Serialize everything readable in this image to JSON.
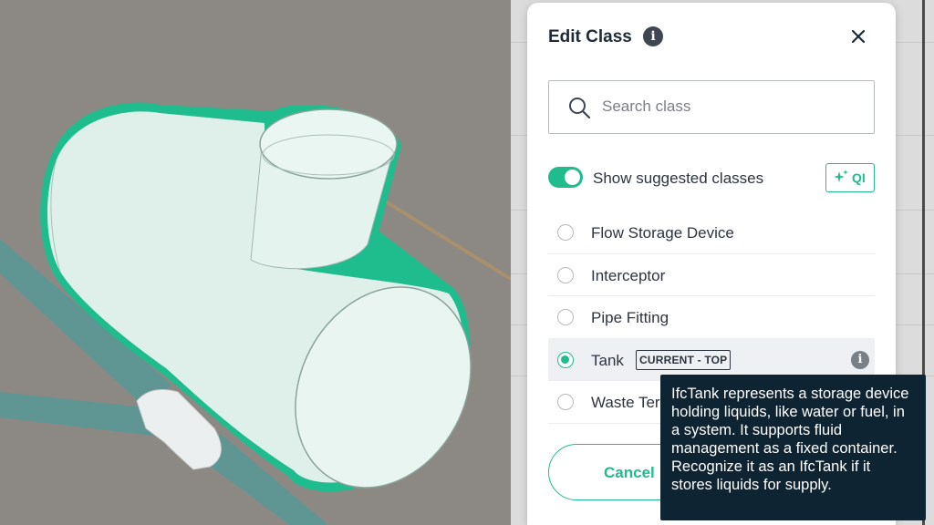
{
  "dialog": {
    "title": "Edit Class",
    "info_icon": "info-icon",
    "close_icon": "close-icon"
  },
  "search": {
    "placeholder": "Search class",
    "icon": "search-icon"
  },
  "suggestions": {
    "toggle_on": true,
    "label": "Show suggested classes",
    "qi_label": "QI",
    "qi_icon": "sparkle-icon"
  },
  "classes": [
    {
      "label": "Flow Storage Device",
      "selected": false
    },
    {
      "label": "Interceptor",
      "selected": false
    },
    {
      "label": "Pipe Fitting",
      "selected": false
    },
    {
      "label": "Tank",
      "selected": true,
      "badge": "CURRENT - TOP"
    },
    {
      "label": "Waste Ter",
      "selected": false
    }
  ],
  "buttons": {
    "cancel": "Cancel"
  },
  "tooltip": {
    "text": "IfcTank represents a storage device holding liquids, like water or fuel, in a system. It supports fluid management as a fixed container. Recognize it as an IfcTank if it stores liquids for supply."
  },
  "colors": {
    "accent": "#1fbc8d",
    "tooltip_bg": "#0f2433",
    "viewport_bg": "#8c8985",
    "tank_fill": "#dff0ea",
    "pipe": "#5f9693"
  }
}
